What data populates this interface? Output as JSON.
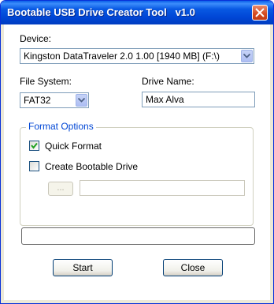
{
  "window": {
    "title": "Bootable USB Drive Creator Tool   v1.0"
  },
  "device": {
    "label": "Device:",
    "selected": "Kingston DataTraveler 2.0 1.00 [1940 MB] (F:\\)"
  },
  "file_system": {
    "label": "File System:",
    "selected": "FAT32"
  },
  "drive_name": {
    "label": "Drive Name:",
    "value": "Max Alva"
  },
  "format_options": {
    "title": "Format Options",
    "quick_format": {
      "label": "Quick Format",
      "checked": true
    },
    "create_bootable": {
      "label": "Create Bootable Drive",
      "checked": false
    },
    "browse_label": "...",
    "path_value": ""
  },
  "progress": {
    "value": 0
  },
  "buttons": {
    "start": "Start",
    "close": "Close"
  },
  "colors": {
    "title_bar": "#0054e3",
    "group_title": "#0046d5",
    "window_bg": "#ffffff"
  }
}
